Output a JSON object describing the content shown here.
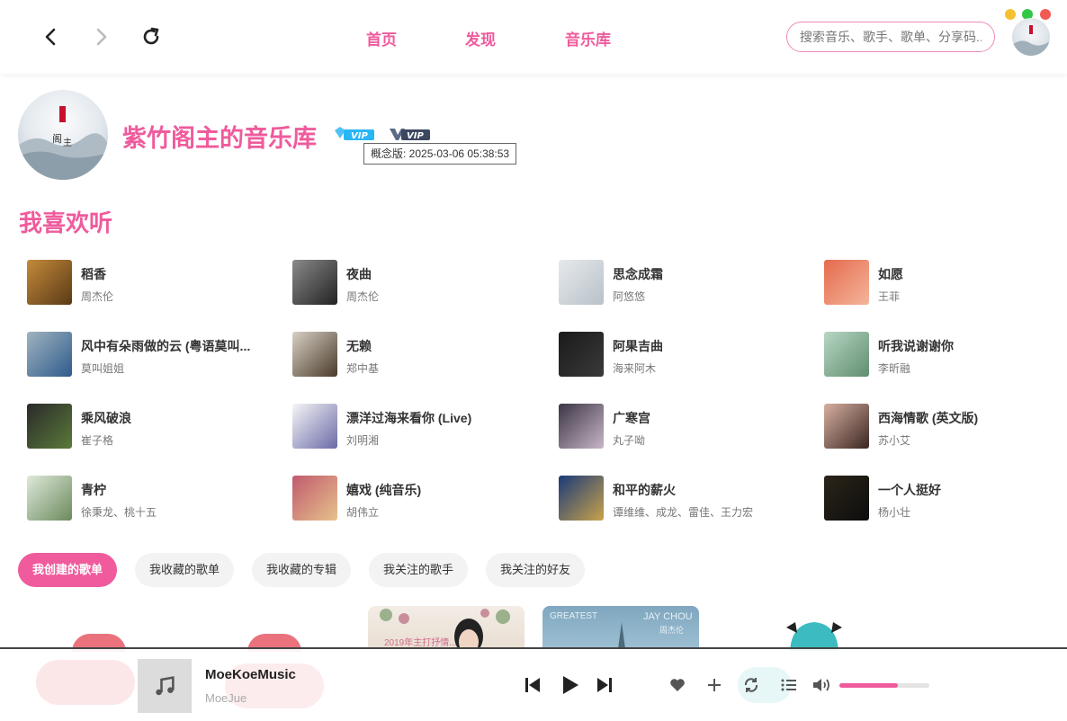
{
  "nav": {
    "home": "首页",
    "discover": "发现",
    "library": "音乐库"
  },
  "search": {
    "placeholder": "搜索音乐、歌手、歌单、分享码..."
  },
  "window_controls": {
    "colors": [
      "#f5c02f",
      "#33c748",
      "#f25a53"
    ]
  },
  "profile": {
    "title": "紫竹阁主的音乐库",
    "vip_badge_1": "VIP",
    "vip_badge_2": "VIP",
    "tooltip": "概念版: 2025-03-06 05:38:53"
  },
  "favorites": {
    "title": "我喜欢听",
    "songs": [
      {
        "name": "稻香",
        "artist": "周杰伦"
      },
      {
        "name": "夜曲",
        "artist": "周杰伦"
      },
      {
        "name": "思念成霜",
        "artist": "阿悠悠"
      },
      {
        "name": "如愿",
        "artist": "王菲"
      },
      {
        "name": "风中有朵雨做的云 (粤语莫叫...",
        "artist": "莫叫姐姐"
      },
      {
        "name": "无赖",
        "artist": "郑中基"
      },
      {
        "name": "阿果吉曲",
        "artist": "海来阿木"
      },
      {
        "name": "听我说谢谢你",
        "artist": "李昕融"
      },
      {
        "name": "乘风破浪",
        "artist": "崔子格"
      },
      {
        "name": "漂洋过海来看你 (Live)",
        "artist": "刘明湘"
      },
      {
        "name": "广寒宫",
        "artist": "丸子呦"
      },
      {
        "name": "西海情歌 (英文版)",
        "artist": "苏小艾"
      },
      {
        "name": "青柠",
        "artist": "徐秉龙、桃十五"
      },
      {
        "name": "嬉戏 (纯音乐)",
        "artist": "胡伟立"
      },
      {
        "name": "和平的薪火",
        "artist": "谭维维、成龙、雷佳、王力宏"
      },
      {
        "name": "一个人挺好",
        "artist": "杨小壮"
      }
    ]
  },
  "tabs": [
    {
      "label": "我创建的歌单",
      "active": true
    },
    {
      "label": "我收藏的歌单",
      "active": false
    },
    {
      "label": "我收藏的专辑",
      "active": false
    },
    {
      "label": "我关注的歌手",
      "active": false
    },
    {
      "label": "我关注的好友",
      "active": false
    }
  ],
  "playlist_previews": {
    "card3_text": "2019年主打抒情...",
    "card4_text_left": "GREATEST",
    "card4_text_right": "JAY CHOU",
    "card4_text_sub": "周杰伦"
  },
  "player": {
    "title": "MoeKoeMusic",
    "subtitle": "MoeJue",
    "volume": 0.65
  },
  "colors": {
    "accent": "#ef5b9c"
  }
}
